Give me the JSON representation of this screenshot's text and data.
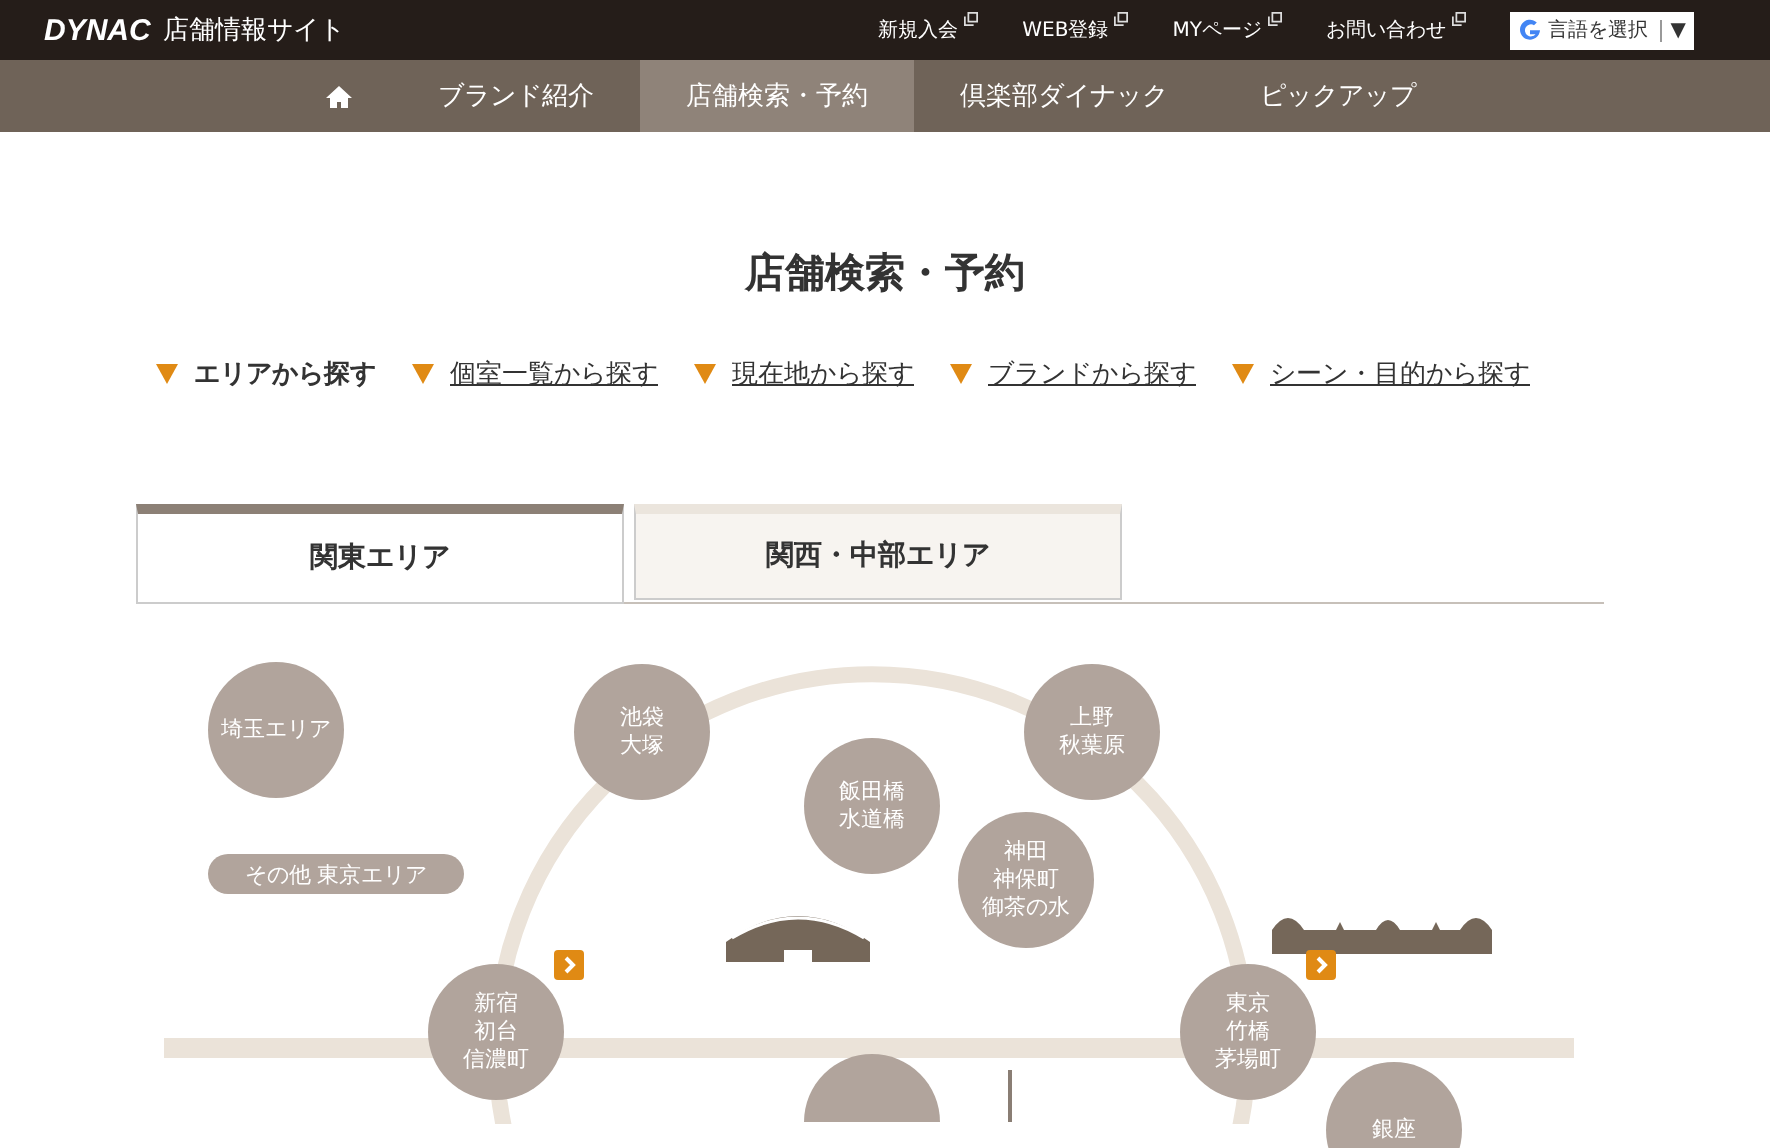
{
  "header": {
    "logo": "DYNAC",
    "site_title": "店舗情報サイト",
    "links": [
      {
        "label": "新規入会"
      },
      {
        "label": "WEB登録"
      },
      {
        "label": "MYページ"
      },
      {
        "label": "お問い合わせ"
      }
    ],
    "translate": {
      "label": "言語を選択",
      "arrow": "▼"
    }
  },
  "nav": [
    {
      "kind": "home",
      "selected": false
    },
    {
      "kind": "text",
      "label": "ブランド紹介",
      "selected": false
    },
    {
      "kind": "text",
      "label": "店舗検索・予約",
      "selected": true
    },
    {
      "kind": "text",
      "label": "倶楽部ダイナック",
      "selected": false
    },
    {
      "kind": "text",
      "label": "ピックアップ",
      "selected": false
    }
  ],
  "page_title": "店舗検索・予約",
  "search_modes": [
    {
      "label": "エリアから探す",
      "selected": true
    },
    {
      "label": "個室一覧から探す",
      "selected": false
    },
    {
      "label": "現在地から探す",
      "selected": false
    },
    {
      "label": "ブランドから探す",
      "selected": false
    },
    {
      "label": "シーン・目的から探す",
      "selected": false
    }
  ],
  "tabs": [
    {
      "label": "関東エリア",
      "selected": true
    },
    {
      "label": "関西・中部エリア",
      "selected": false
    }
  ],
  "map": {
    "areas": [
      {
        "lines": [
          "埼玉エリア"
        ],
        "more": false
      },
      {
        "lines": [
          "池袋",
          "大塚"
        ],
        "more": false
      },
      {
        "lines": [
          "上野",
          "秋葉原"
        ],
        "more": false
      },
      {
        "lines": [
          "飯田橋",
          "水道橋"
        ],
        "more": false
      },
      {
        "lines": [
          "神田",
          "神保町",
          "御茶の水"
        ],
        "more": false
      },
      {
        "lines": [
          "新宿",
          "初台",
          "信濃町"
        ],
        "more": true
      },
      {
        "lines": [
          "東京",
          "竹橋",
          "茅場町"
        ],
        "more": true
      },
      {
        "lines": [
          "銀座"
        ],
        "more": false
      }
    ],
    "other_area": "その他 東京エリア"
  }
}
